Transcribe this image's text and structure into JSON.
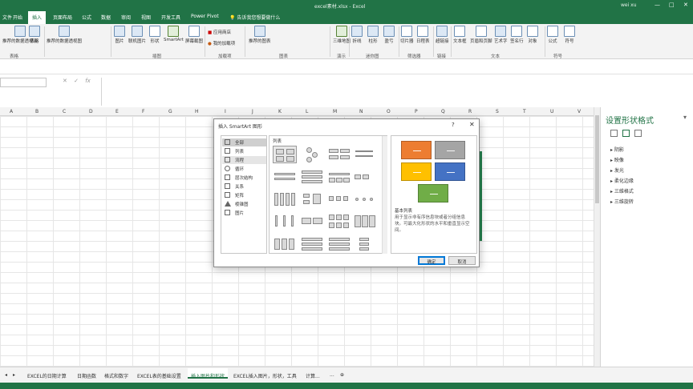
{
  "window": {
    "title": "excel素材.xlsx - Excel",
    "user": "wei xu",
    "min": "—",
    "max": "□",
    "close": "✕"
  },
  "tabs": [
    "文件",
    "开始",
    "插入",
    "页面布局",
    "公式",
    "数据",
    "审阅",
    "视图",
    "开发工具",
    "Power Pivot"
  ],
  "active_tab": "插入",
  "tell_me": "告诉我您想要做什么",
  "ribbon": {
    "buttons": [
      {
        "label": "推荐的数据透视表",
        "icon": "pivot-icon"
      },
      {
        "label": "表格",
        "icon": "table-icon"
      },
      {
        "label": "推荐的数据透视图",
        "icon": "recommended-chart-icon"
      },
      {
        "label": "图片",
        "icon": "picture-icon"
      },
      {
        "label": "联机图片",
        "icon": "online-picture-icon"
      },
      {
        "label": "形状",
        "icon": "shapes-icon"
      },
      {
        "label": "SmartArt",
        "icon": "smartart-icon"
      },
      {
        "label": "屏幕截图",
        "icon": "screenshot-icon"
      },
      {
        "label": "应用商店",
        "icon": "store-icon"
      },
      {
        "label": "我的加载项",
        "icon": "addins-icon"
      },
      {
        "label": "推荐的图表",
        "icon": "chart-icon"
      },
      {
        "label": "三维地图",
        "icon": "map-icon"
      },
      {
        "label": "折线",
        "icon": "sparkline-line-icon"
      },
      {
        "label": "柱形",
        "icon": "sparkline-column-icon"
      },
      {
        "label": "盈亏",
        "icon": "sparkline-winloss-icon"
      },
      {
        "label": "切片器",
        "icon": "slicer-icon"
      },
      {
        "label": "日程表",
        "icon": "timeline-icon"
      },
      {
        "label": "超链接",
        "icon": "link-icon"
      },
      {
        "label": "文本框",
        "icon": "textbox-icon"
      },
      {
        "label": "页眉和页脚",
        "icon": "header-icon"
      },
      {
        "label": "艺术字",
        "icon": "wordart-icon"
      },
      {
        "label": "签名行",
        "icon": "signature-icon"
      },
      {
        "label": "对象",
        "icon": "object-icon"
      },
      {
        "label": "公式",
        "icon": "pi-icon"
      },
      {
        "label": "符号",
        "icon": "omega-icon"
      }
    ],
    "groups": [
      "表格",
      "插图",
      "加载项",
      "图表",
      "演示",
      "迷你图",
      "筛选器",
      "链接",
      "文本",
      "符号"
    ]
  },
  "formula_bar": {
    "fx": "fx"
  },
  "columns": [
    "A",
    "B",
    "C",
    "D",
    "E",
    "F",
    "G",
    "H",
    "I",
    "J",
    "K",
    "L",
    "M",
    "N",
    "O",
    "P",
    "Q",
    "R",
    "S",
    "T",
    "U",
    "V"
  ],
  "dialog": {
    "title": "插入 SmartArt 图形",
    "help": "?",
    "close": "✕",
    "categories": [
      {
        "label": "全部",
        "icon": "all-icon",
        "state": "selected"
      },
      {
        "label": "列表",
        "icon": "list-icon"
      },
      {
        "label": "流程",
        "icon": "process-icon",
        "state": "hover"
      },
      {
        "label": "循环",
        "icon": "cycle-icon"
      },
      {
        "label": "层次结构",
        "icon": "hierarchy-icon"
      },
      {
        "label": "关系",
        "icon": "relationship-icon"
      },
      {
        "label": "矩阵",
        "icon": "matrix-icon"
      },
      {
        "label": "棱锥图",
        "icon": "pyramid-icon"
      },
      {
        "label": "图片",
        "icon": "picture-icon"
      }
    ],
    "gallery_header": "列表",
    "preview_title": "基本列表",
    "preview_desc": "用于显示非有序信息块或者分组信息块。可最大化形状的水平和垂直显示空间。",
    "preview_colors": [
      "#ed7d31",
      "#a5a5a5",
      "#ffc000",
      "#4472c4",
      "#70ad47"
    ],
    "ok": "确定",
    "cancel": "取消"
  },
  "pane": {
    "title": "设置形状格式",
    "sections": [
      "阴影",
      "映像",
      "发光",
      "柔化边缘",
      "三维格式",
      "三维旋转"
    ]
  },
  "sheets": [
    "EXCEL的日期计算",
    "日期函数",
    "格式和数字",
    "EXCEL表的基础设置",
    "插入图片和形状",
    "EXCEL插入图片，形状，工具",
    "计算...",
    "..."
  ],
  "active_sheet": "插入图片和形状"
}
